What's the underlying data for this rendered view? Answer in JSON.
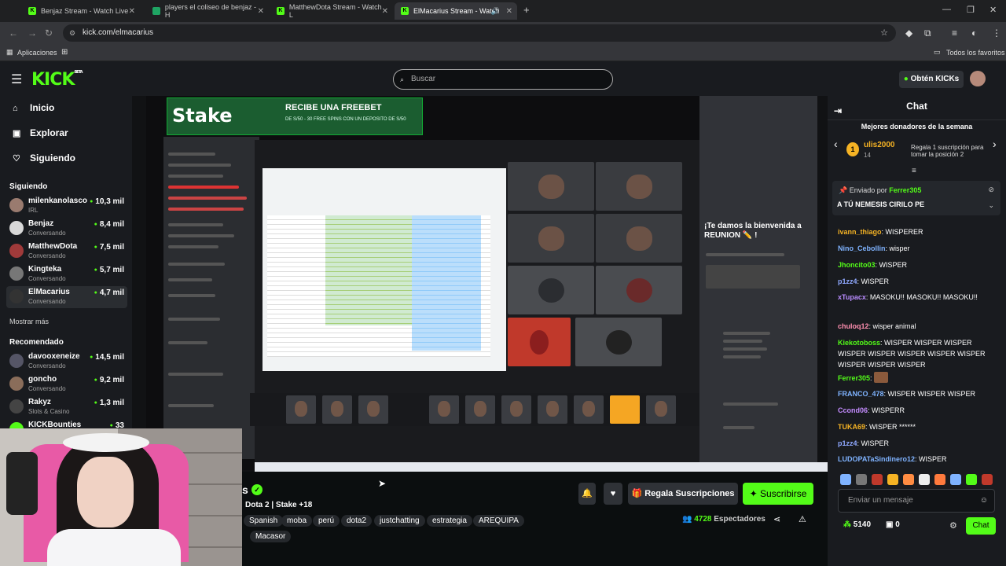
{
  "browser": {
    "tabs": [
      {
        "title": "Benjaz Stream - Watch Live",
        "favicon": "kick-favicon"
      },
      {
        "title": "players el coliseo de benjaz - H",
        "favicon": "sheets-favicon"
      },
      {
        "title": "MatthewDota Stream - Watch L",
        "favicon": "kick-favicon"
      },
      {
        "title": "ElMacarius Stream - Watch",
        "favicon": "kick-favicon"
      }
    ],
    "url": "kick.com/elmacarius",
    "bookmarks": {
      "apps": "Aplicaciones",
      "favorites": "Todos los favoritos"
    }
  },
  "header": {
    "logo": "KICK",
    "logo_badge": "BETA",
    "search_placeholder": "Buscar",
    "get_kicks": "Obtén KICKs"
  },
  "sidebar": {
    "nav": [
      {
        "label": "Inicio",
        "icon": "home-icon"
      },
      {
        "label": "Explorar",
        "icon": "compass-icon"
      },
      {
        "label": "Siguiendo",
        "icon": "heart-icon"
      }
    ],
    "following_title": "Siguiendo",
    "following": [
      {
        "name": "milenkanolasco",
        "category": "IRL",
        "viewers": "10,3 mil",
        "color": "#9a7b6f"
      },
      {
        "name": "Benjaz",
        "category": "Conversando",
        "viewers": "8,4 mil",
        "color": "#d8d8d8"
      },
      {
        "name": "MatthewDota",
        "category": "Conversando",
        "viewers": "7,5 mil",
        "color": "#a03a3a"
      },
      {
        "name": "Kingteka",
        "category": "Conversando",
        "viewers": "5,7 mil",
        "color": "#777"
      },
      {
        "name": "ElMacarius",
        "category": "Conversando",
        "viewers": "4,7 mil",
        "color": "#333"
      }
    ],
    "show_more": "Mostrar más",
    "recommended_title": "Recomendado",
    "recommended": [
      {
        "name": "davooxeneize",
        "category": "Conversando",
        "viewers": "14,5 mil",
        "color": "#556"
      },
      {
        "name": "goncho",
        "category": "Conversando",
        "viewers": "9,2 mil",
        "color": "#8a6d5a"
      },
      {
        "name": "Rakyz",
        "category": "Slots & Casino",
        "viewers": "1,3 mil",
        "color": "#444"
      },
      {
        "name": "KICKBounties",
        "category": "",
        "viewers": "33",
        "color": "#53fc18"
      }
    ]
  },
  "video": {
    "ad_brand": "Stake",
    "ad_promo": "RECIBE UNA FREEBET",
    "ad_promo_small": "DE S/50 - 30 FREE SPINS CON UN DEPOSITO DE S/50",
    "discord_welcome": "¡Te damos la bienvenida a REUNION ✏️ !"
  },
  "stream": {
    "title": "s",
    "category": "Dota 2 | Stake +18",
    "tags": [
      "Spanish",
      "moba",
      "perú",
      "dota2",
      "justchatting",
      "estrategia",
      "AREQUIPA",
      "Macasor"
    ],
    "gift_label": "Regala Suscripciones",
    "subscribe_label": "Suscribirse",
    "viewers_count": "4728",
    "viewers_label": "Espectadores"
  },
  "chat": {
    "title": "Chat",
    "donors_title": "Mejores donadores de la semana",
    "top_donor": {
      "rank": "1",
      "name": "ulis2000",
      "count": "14"
    },
    "gift_prompt": "Regala 1 suscripción para tomar la posición 2",
    "pinned": {
      "sent_by": "Enviado por",
      "user": "Ferrer305",
      "message": "A TÚ NEMESIS CIRILO PE"
    },
    "messages": [
      {
        "user": "ivann_thiago",
        "color": "#f5b324",
        "text": "WISPERER"
      },
      {
        "user": "Nino_Cebollin",
        "color": "#7fb3ff",
        "text": "wisper"
      },
      {
        "user": "Jhoncito03",
        "color": "#53fc18",
        "text": "WISPER"
      },
      {
        "user": "p1zz4",
        "color": "#8fa8ff",
        "text": "WISPER"
      },
      {
        "user": "xTupacx",
        "color": "#b98cff",
        "text": "MASOKU!! MASOKU!! MASOKU!!"
      },
      {
        "user": "chuloq12",
        "color": "#ff8fb0",
        "text": "wisper animal"
      },
      {
        "user": "Kiekotoboss",
        "color": "#53fc18",
        "text": "WISPER WISPER WISPER WISPER WISPER WISPER WISPER WISPER WISPER WISPER WISPER"
      },
      {
        "user": "Ferrer305",
        "color": "#53fc18",
        "text": ""
      },
      {
        "user": "FRANCO_478",
        "color": "#7fb3ff",
        "text": "WISPER WISPER WISPER"
      },
      {
        "user": "Ccond06",
        "color": "#c48cff",
        "text": "WISPERR"
      },
      {
        "user": "TUKA69",
        "color": "#f5b324",
        "text": "WISPER ******"
      },
      {
        "user": "p1zz4",
        "color": "#8fa8ff",
        "text": "WISPER"
      },
      {
        "user": "LUDOPATaSindinero12",
        "color": "#7fb3ff",
        "text": "WISPER"
      }
    ],
    "input_placeholder": "Enviar un mensaje",
    "points": "5140",
    "points2": "0",
    "send_label": "Chat"
  },
  "colors": {
    "accent": "#53fc18",
    "bg": "#0b0e0f",
    "panel": "#191b1f"
  }
}
